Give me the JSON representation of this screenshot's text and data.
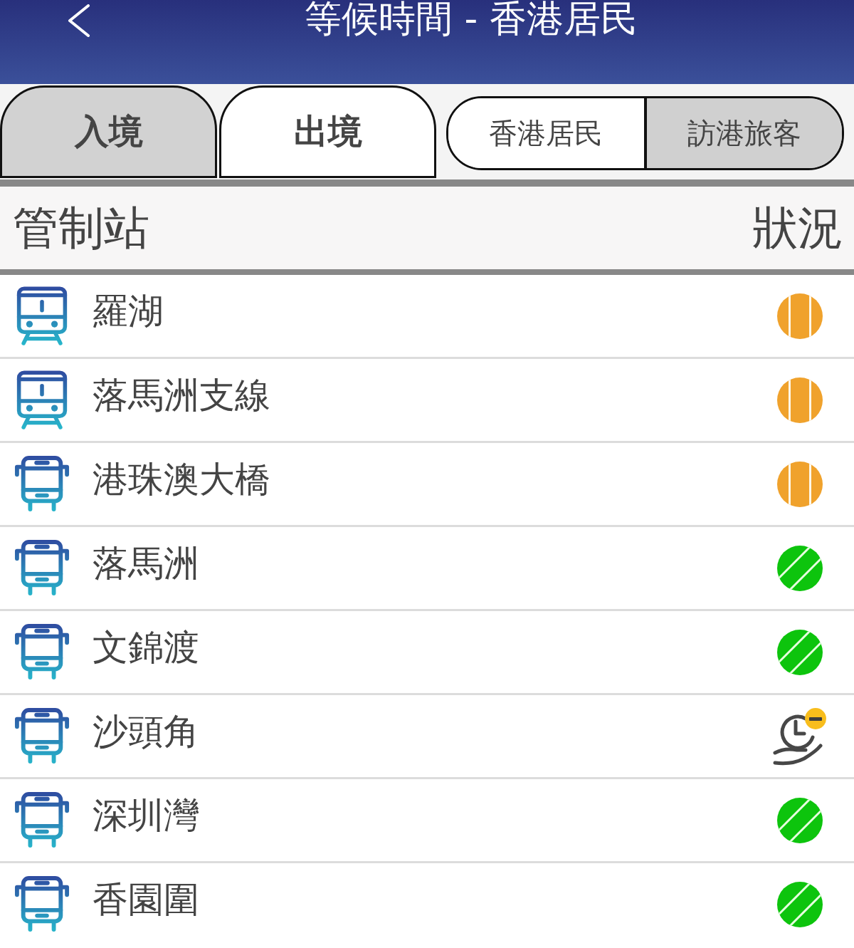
{
  "header": {
    "title": "等候時間 - 香港居民"
  },
  "direction_tabs": [
    {
      "label": "入境",
      "selected": false
    },
    {
      "label": "出境",
      "selected": true
    }
  ],
  "traveller_toggle": [
    {
      "label": "香港居民",
      "selected": true
    },
    {
      "label": "訪港旅客",
      "selected": false
    }
  ],
  "table": {
    "columns": [
      "管制站",
      "狀況"
    ]
  },
  "stations": [
    {
      "name": "羅湖",
      "kind": "train",
      "status": {
        "kind": "vertical_stripes",
        "color": "#f0a22c"
      }
    },
    {
      "name": "落馬洲支線",
      "kind": "train",
      "status": {
        "kind": "vertical_stripes",
        "color": "#f0a22c"
      }
    },
    {
      "name": "港珠澳大橋",
      "kind": "bus",
      "status": {
        "kind": "vertical_stripes",
        "color": "#f0a22c"
      }
    },
    {
      "name": "落馬洲",
      "kind": "bus",
      "status": {
        "kind": "diagonal_stripes",
        "color": "#0dc40d"
      }
    },
    {
      "name": "文錦渡",
      "kind": "bus",
      "status": {
        "kind": "diagonal_stripes",
        "color": "#0dc40d"
      }
    },
    {
      "name": "沙頭角",
      "kind": "bus",
      "status": {
        "kind": "clock_hand"
      }
    },
    {
      "name": "深圳灣",
      "kind": "bus",
      "status": {
        "kind": "diagonal_stripes",
        "color": "#0dc40d"
      }
    },
    {
      "name": "香園圍",
      "kind": "bus",
      "status": {
        "kind": "diagonal_stripes",
        "color": "#0dc40d"
      }
    }
  ]
}
